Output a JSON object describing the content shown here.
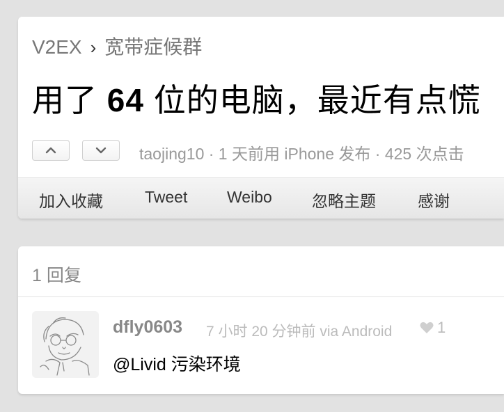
{
  "breadcrumb": {
    "site": "V2EX",
    "separator": "›",
    "node": "宽带症候群"
  },
  "topic": {
    "title_prefix": "用了",
    "title_bold": "64",
    "title_suffix": "位的电脑，最近有点慌",
    "author": "taojing10",
    "meta_rest": " · 1 天前用 iPhone 发布 · 425 次点击"
  },
  "toolbar": {
    "favorite": "加入收藏",
    "tweet": "Tweet",
    "weibo": "Weibo",
    "ignore": "忽略主题",
    "thank": "感谢"
  },
  "replies": {
    "count_label": "1 回复",
    "items": [
      {
        "author": "dfly0603",
        "time": "7 小时 20 分钟前 via Android",
        "thanks": "1",
        "content": "@Livid 污染环境"
      }
    ]
  },
  "icons": {
    "vote_up": "chevron-up-icon",
    "vote_down": "chevron-down-icon",
    "thanks": "heart-icon"
  }
}
